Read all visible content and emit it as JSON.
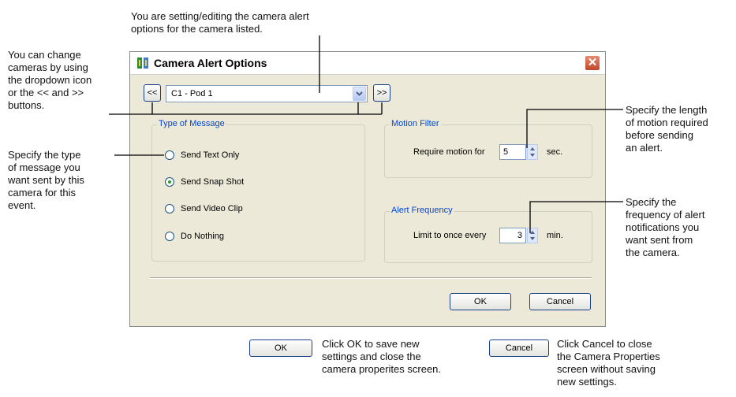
{
  "annotations": {
    "top": "You are setting/editing the camera alert\noptions for the camera listed.",
    "left_camera": "You can change\ncameras by using\nthe dropdown icon\nor the << and >>\nbuttons.",
    "left_message": "Specify the type\nof message you\nwant sent by this\ncamera for this\nevent.",
    "right_motion": "Specify the length\nof motion required\nbefore sending\nan alert.",
    "right_frequency": "Specify the\nfrequency of alert\nnotifications you\nwant sent from\nthe camera.",
    "bottom_ok": "Click OK to save new\nsettings and close the\ncamera properites screen.",
    "bottom_cancel": "Click Cancel to close\nthe Camera Properties\nscreen without saving\nnew settings."
  },
  "dialog": {
    "title": "Camera Alert Options",
    "close_symbol": "✕",
    "prev_label": "<<",
    "next_label": ">>",
    "camera_selected": "C1 - Pod 1",
    "message_group": {
      "label": "Type of Message",
      "options": [
        {
          "label": "Send Text Only",
          "checked": false
        },
        {
          "label": "Send Snap Shot",
          "checked": true
        },
        {
          "label": "Send Video Clip",
          "checked": false
        },
        {
          "label": "Do Nothing",
          "checked": false
        }
      ]
    },
    "motion_filter": {
      "label": "Motion Filter",
      "field_label": "Require motion for",
      "value": "5",
      "unit": "sec."
    },
    "alert_frequency": {
      "label": "Alert Frequency",
      "field_label": "Limit to once every",
      "value": "3",
      "unit": "min."
    },
    "ok_label": "OK",
    "cancel_label": "Cancel"
  },
  "legend": {
    "ok_label": "OK",
    "cancel_label": "Cancel"
  },
  "colors": {
    "dialog_bg": "#ece9d8",
    "group_label": "#0046d5",
    "close_button": "#c1462b"
  }
}
